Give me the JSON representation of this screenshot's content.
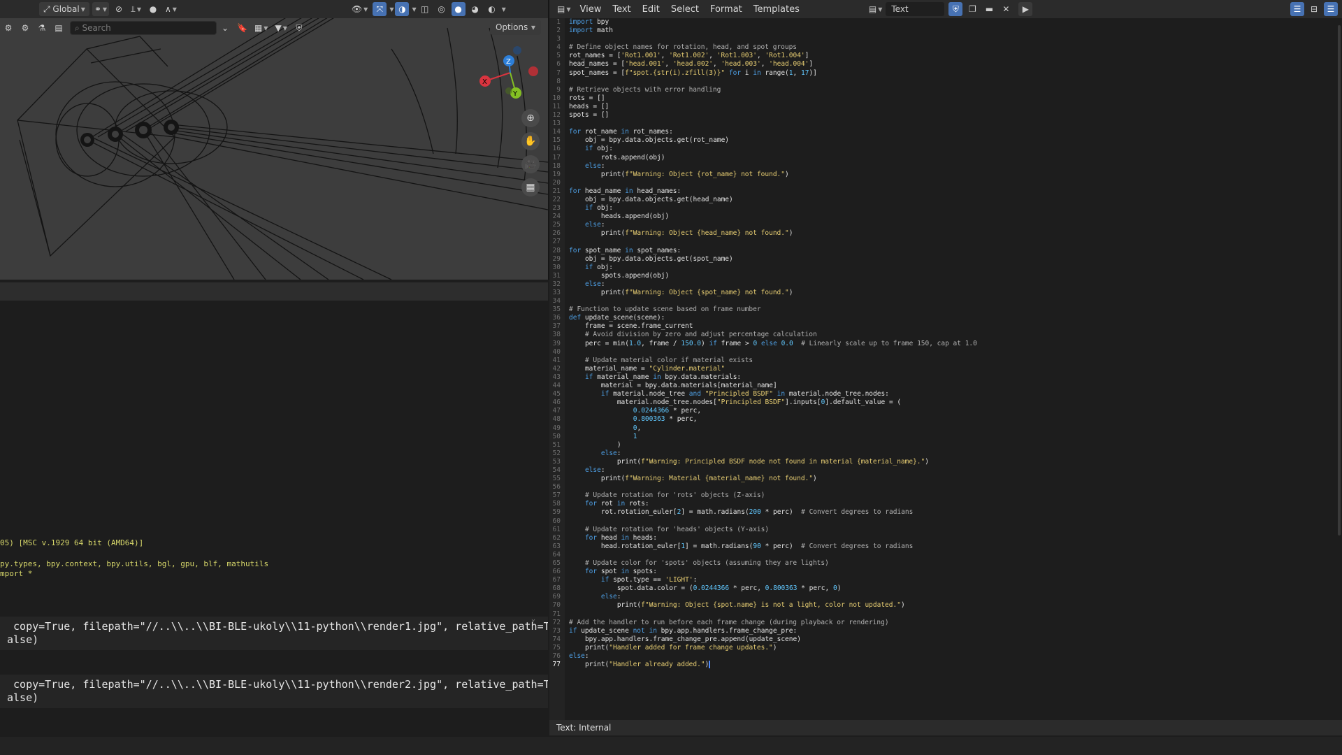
{
  "viewport": {
    "global_label": "Global",
    "search_placeholder": "Search",
    "options_label": "Options",
    "axis_labels": {
      "x": "X",
      "y": "Y",
      "z": "Z"
    },
    "colors": {
      "background": "#3d3d3d",
      "wire": "#161616",
      "x_axis": "#d9343f",
      "y_axis": "#84c023",
      "z_axis": "#2d7fd9"
    },
    "nav_icons": [
      "zoom-icon",
      "pan-hand-icon",
      "camera-icon",
      "grid-icon"
    ]
  },
  "console": {
    "lines": [
      "05) [MSC v.1929 64 bit (AMD64)]",
      "",
      "py.types, bpy.context, bpy.utils, bgl, gpu, blf, mathutils",
      "mport *"
    ],
    "blocks": [
      " copy=True, filepath=\"//..\\\\..\\\\BI-BLE-ukoly\\\\11-python\\\\render1.jpg\", relative_path=Tr\nalse)",
      " copy=True, filepath=\"//..\\\\..\\\\BI-BLE-ukoly\\\\11-python\\\\render2.jpg\", relative_path=Tr\nalse)"
    ]
  },
  "editor": {
    "menus": [
      "View",
      "Text",
      "Edit",
      "Select",
      "Format",
      "Templates"
    ],
    "text_name": "Text",
    "footer": "Text: Internal",
    "current_line": 77,
    "lines": [
      "import bpy",
      "import math",
      "",
      "# Define object names for rotation, head, and spot groups",
      "rot_names = ['Rot1.001', 'Rot1.002', 'Rot1.003', 'Rot1.004']",
      "head_names = ['head.001', 'head.002', 'head.003', 'head.004']",
      "spot_names = [f\"spot.{str(i).zfill(3)}\" for i in range(1, 17)]",
      "",
      "# Retrieve objects with error handling",
      "rots = []",
      "heads = []",
      "spots = []",
      "",
      "for rot_name in rot_names:",
      "    obj = bpy.data.objects.get(rot_name)",
      "    if obj:",
      "        rots.append(obj)",
      "    else:",
      "        print(f\"Warning: Object {rot_name} not found.\")",
      "",
      "for head_name in head_names:",
      "    obj = bpy.data.objects.get(head_name)",
      "    if obj:",
      "        heads.append(obj)",
      "    else:",
      "        print(f\"Warning: Object {head_name} not found.\")",
      "",
      "for spot_name in spot_names:",
      "    obj = bpy.data.objects.get(spot_name)",
      "    if obj:",
      "        spots.append(obj)",
      "    else:",
      "        print(f\"Warning: Object {spot_name} not found.\")",
      "",
      "# Function to update scene based on frame number",
      "def update_scene(scene):",
      "    frame = scene.frame_current",
      "    # Avoid division by zero and adjust percentage calculation",
      "    perc = min(1.0, frame / 150.0) if frame > 0 else 0.0  # Linearly scale up to frame 150, cap at 1.0",
      "",
      "    # Update material color if material exists",
      "    material_name = \"Cylinder.material\"",
      "    if material_name in bpy.data.materials:",
      "        material = bpy.data.materials[material_name]",
      "        if material.node_tree and \"Principled BSDF\" in material.node_tree.nodes:",
      "            material.node_tree.nodes[\"Principled BSDF\"].inputs[0].default_value = (",
      "                0.0244366 * perc,",
      "                0.800363 * perc,",
      "                0,",
      "                1",
      "            )",
      "        else:",
      "            print(f\"Warning: Principled BSDF node not found in material {material_name}.\")",
      "    else:",
      "        print(f\"Warning: Material {material_name} not found.\")",
      "",
      "    # Update rotation for 'rots' objects (Z-axis)",
      "    for rot in rots:",
      "        rot.rotation_euler[2] = math.radians(200 * perc)  # Convert degrees to radians",
      "",
      "    # Update rotation for 'heads' objects (Y-axis)",
      "    for head in heads:",
      "        head.rotation_euler[1] = math.radians(90 * perc)  # Convert degrees to radians",
      "",
      "    # Update color for 'spots' objects (assuming they are lights)",
      "    for spot in spots:",
      "        if spot.type == 'LIGHT':",
      "            spot.data.color = (0.0244366 * perc, 0.800363 * perc, 0)",
      "        else:",
      "            print(f\"Warning: Object {spot.name} is not a light, color not updated.\")",
      "",
      "# Add the handler to run before each frame change (during playback or rendering)",
      "if update_scene not in bpy.app.handlers.frame_change_pre:",
      "    bpy.app.handlers.frame_change_pre.append(update_scene)",
      "    print(\"Handler added for frame change updates.\")",
      "else:",
      "    print(\"Handler already added.\")"
    ]
  }
}
